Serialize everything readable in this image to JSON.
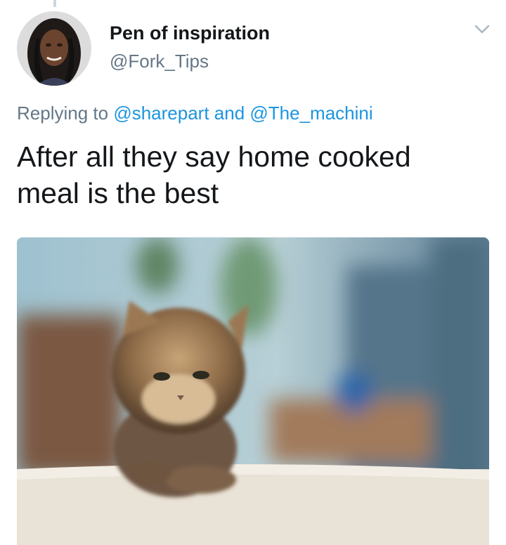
{
  "tweet": {
    "display_name": "Pen of inspiration",
    "handle": "@Fork_Tips",
    "reply_prefix": "Replying to",
    "reply_mentions": [
      "@sharepart",
      "@The_machini"
    ],
    "reply_joiner": "and",
    "text": "After all they say home cooked meal is the best",
    "menu_icon": "chevron-down-icon",
    "avatar_icon": "profile-photo",
    "media_icon": "kitten-photo"
  },
  "colors": {
    "name": "#14171a",
    "secondary": "#657786",
    "link": "#1b95e0"
  }
}
